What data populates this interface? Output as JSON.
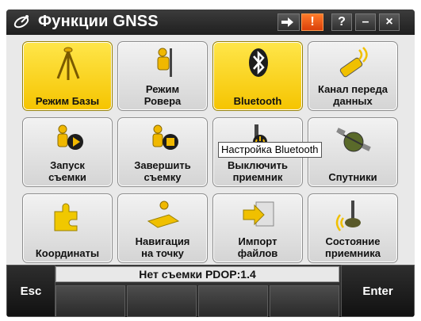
{
  "window": {
    "title": "Функции GNSS",
    "buttons": {
      "help": "?",
      "minimize": "–",
      "close": "×",
      "alert": "!"
    }
  },
  "tiles": [
    {
      "label": "Режим Базы",
      "icon": "tripod-base-icon",
      "active": true
    },
    {
      "label_line1": "Режим",
      "label_line2": "Ровера",
      "icon": "rover-surveyor-icon",
      "active": false
    },
    {
      "label": "Bluetooth",
      "icon": "bluetooth-icon",
      "active": true
    },
    {
      "label_line1": "Канал переда",
      "label_line2": "данных",
      "icon": "radio-data-link-icon",
      "active": false
    },
    {
      "label_line1": "Запуск",
      "label_line2": "съемки",
      "icon": "start-survey-icon",
      "active": false
    },
    {
      "label_line1": "Завершить",
      "label_line2": "съемку",
      "icon": "end-survey-icon",
      "active": false
    },
    {
      "label_line1": "Выключить",
      "label_line2": "приемник",
      "icon": "power-off-receiver-icon",
      "active": false
    },
    {
      "label": "Спутники",
      "icon": "satellite-icon",
      "active": false
    },
    {
      "label": "Координаты",
      "icon": "coordinates-puzzle-icon",
      "active": false
    },
    {
      "label_line1": "Навигация",
      "label_line2": "на точку",
      "icon": "navigate-to-point-icon",
      "active": false
    },
    {
      "label_line1": "Импорт",
      "label_line2": "файлов",
      "icon": "import-files-icon",
      "active": false
    },
    {
      "label_line1": "Состояние",
      "label_line2": "приемника",
      "icon": "receiver-status-icon",
      "active": false
    }
  ],
  "tooltip": "Настройка Bluetooth",
  "status": "Нет съемки  PDOP:1.4",
  "softkeys": {
    "esc": "Esc",
    "enter": "Enter"
  },
  "colors": {
    "active_tile": "#f5c400",
    "title_bar": "#1f1f1f",
    "alert": "#e8501a"
  }
}
